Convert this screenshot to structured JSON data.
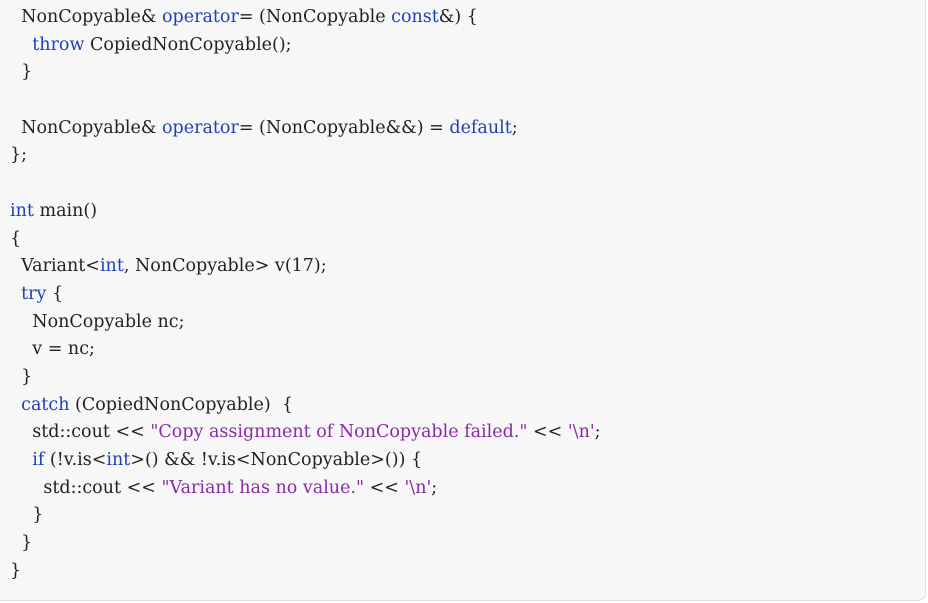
{
  "colors": {
    "background": "#f7f7f7",
    "text": "#222222",
    "keyword": "#1f3fb8",
    "string": "#8a2aa8"
  },
  "code": {
    "lines": [
      [
        {
          "t": "  NonCopyable& "
        },
        {
          "t": "operator",
          "k": "kw"
        },
        {
          "t": "= (NonCopyable "
        },
        {
          "t": "const",
          "k": "kw"
        },
        {
          "t": "&) {"
        }
      ],
      [
        {
          "t": "    "
        },
        {
          "t": "throw",
          "k": "kw"
        },
        {
          "t": " CopiedNonCopyable();"
        }
      ],
      [
        {
          "t": "  }"
        }
      ],
      [
        {
          "t": ""
        }
      ],
      [
        {
          "t": "  NonCopyable& "
        },
        {
          "t": "operator",
          "k": "kw"
        },
        {
          "t": "= (NonCopyable&&) = "
        },
        {
          "t": "default",
          "k": "kw"
        },
        {
          "t": ";"
        }
      ],
      [
        {
          "t": "};"
        }
      ],
      [
        {
          "t": ""
        }
      ],
      [
        {
          "t": "int",
          "k": "kw"
        },
        {
          "t": " main()"
        }
      ],
      [
        {
          "t": "{"
        }
      ],
      [
        {
          "t": "  Variant<"
        },
        {
          "t": "int",
          "k": "kw"
        },
        {
          "t": ", NonCopyable> v(17);"
        }
      ],
      [
        {
          "t": "  "
        },
        {
          "t": "try",
          "k": "kw"
        },
        {
          "t": " {"
        }
      ],
      [
        {
          "t": "    NonCopyable nc;"
        }
      ],
      [
        {
          "t": "    v = nc;"
        }
      ],
      [
        {
          "t": "  }"
        }
      ],
      [
        {
          "t": "  "
        },
        {
          "t": "catch",
          "k": "kw"
        },
        {
          "t": " (CopiedNonCopyable)  {"
        }
      ],
      [
        {
          "t": "    std::cout << "
        },
        {
          "t": "\"Copy assignment of NonCopyable failed.\"",
          "k": "str"
        },
        {
          "t": " << "
        },
        {
          "t": "'\\n'",
          "k": "str"
        },
        {
          "t": ";"
        }
      ],
      [
        {
          "t": "    "
        },
        {
          "t": "if",
          "k": "kw"
        },
        {
          "t": " (!v.is<"
        },
        {
          "t": "int",
          "k": "kw"
        },
        {
          "t": ">() && !v.is<NonCopyable>()) {"
        }
      ],
      [
        {
          "t": "      std::cout << "
        },
        {
          "t": "\"Variant has no value.\"",
          "k": "str"
        },
        {
          "t": " << "
        },
        {
          "t": "'\\n'",
          "k": "str"
        },
        {
          "t": ";"
        }
      ],
      [
        {
          "t": "    }"
        }
      ],
      [
        {
          "t": "  }"
        }
      ],
      [
        {
          "t": "}"
        }
      ]
    ]
  }
}
